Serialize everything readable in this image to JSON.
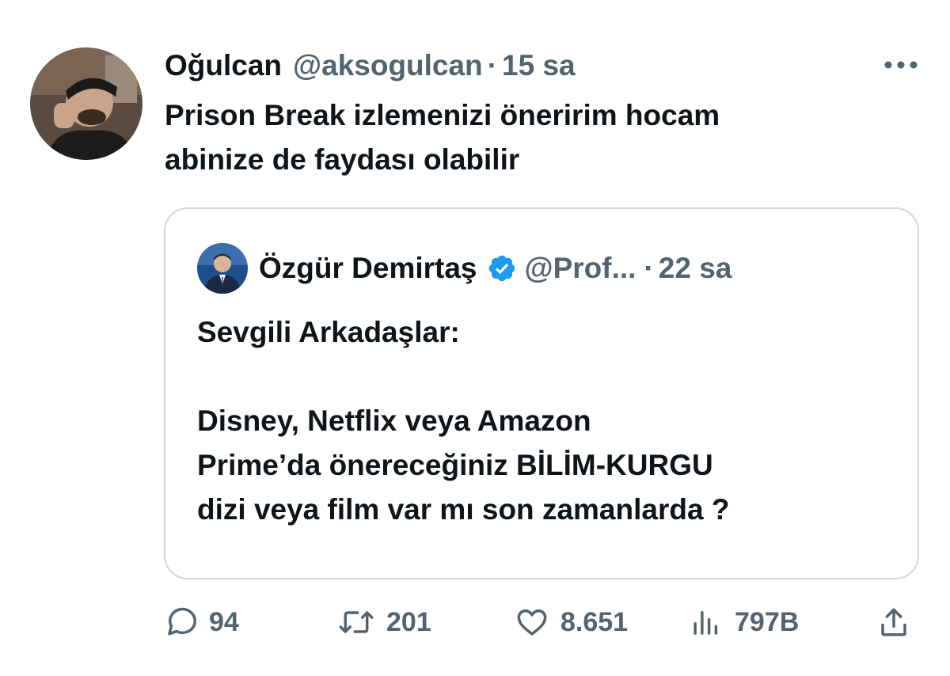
{
  "tweet": {
    "author_name": "Oğulcan",
    "author_handle": "@aksogulcan",
    "separator": "·",
    "time": "15 sa",
    "text_lines": [
      "Prison Break izlemenizi öneririm hocam",
      "abinize de faydası olabilir"
    ]
  },
  "quote": {
    "author_name": "Özgür Demirtaş",
    "author_handle": "@Prof...",
    "separator": "·",
    "time": "22 sa",
    "text_lines": [
      "Sevgili Arkadaşlar:",
      "",
      "Disney, Netflix veya Amazon",
      "Prime’da önereceğiniz BİLİM-KURGU",
      "dizi veya film var mı son zamanlarda ?"
    ]
  },
  "actions": {
    "replies": "94",
    "retweets": "201",
    "likes": "8.651",
    "views": "797B"
  },
  "icons": {
    "more": "more-dots-icon",
    "verified": "verified-badge-icon",
    "reply": "reply-icon",
    "retweet": "retweet-icon",
    "like": "heart-icon",
    "views": "views-icon",
    "share": "share-icon"
  },
  "colors": {
    "text": "#0f1419",
    "secondary": "#536471",
    "border": "#cfd9de",
    "verified": "#1d9bf0"
  }
}
